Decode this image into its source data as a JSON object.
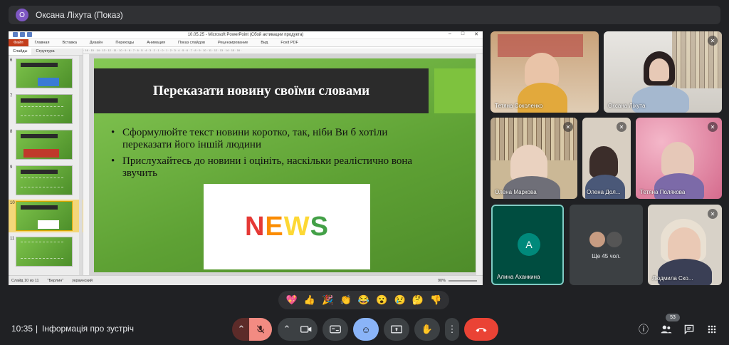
{
  "presenter": {
    "initial": "O",
    "name": "Оксана Ліхута (Показ)"
  },
  "ppt": {
    "window_title": "10.05.25 - Microsoft PowerPoint (Сбой активации продукта)",
    "ribbon_tabs": [
      "Файл",
      "Главная",
      "Вставка",
      "Дизайн",
      "Переходы",
      "Анимация",
      "Показ слайдов",
      "Рецензирование",
      "Вид",
      "Foxit PDF"
    ],
    "panel_tabs": [
      "Слайды",
      "Структура"
    ],
    "thumbnails": [
      {
        "num": "6",
        "title": "Практичне завдання"
      },
      {
        "num": "7",
        "title": "Що нового?"
      },
      {
        "num": "8",
        "title": "Обговорення новин"
      },
      {
        "num": "9",
        "title": "Вправа"
      },
      {
        "num": "10",
        "title": "Переказати новину своїми словами",
        "selected": true
      },
      {
        "num": "11",
        "title": ""
      }
    ],
    "slide": {
      "title": "Переказати новину своїми словами",
      "bullets": [
        "Сформулюйте текст новини коротко, так, ніби Ви б хотіли переказати його іншій людини",
        "Прислухайтесь до новини і оцініть, наскільки реалістично вона звучить"
      ],
      "image_letters": [
        "N",
        "E",
        "W",
        "S"
      ]
    },
    "status": {
      "slide": "Слайд 10 из 11",
      "theme": "\"Берлин\"",
      "lang": "украинский",
      "zoom": "90%"
    }
  },
  "participants": [
    {
      "name": "Тетяна Соколенко",
      "muted": false
    },
    {
      "name": "Оксана Ліхута",
      "muted": true
    },
    {
      "name": "Олена Маркова",
      "muted": true
    },
    {
      "name": "Олена Дол...",
      "muted": true
    },
    {
      "name": "Тетяна Полякова",
      "muted": true
    },
    {
      "name": "Алина Аханкина",
      "initial": "A",
      "muted": false
    },
    {
      "name": "Ще 45 чол.",
      "muted": false
    },
    {
      "name": "Людмила Ско...",
      "muted": true
    }
  ],
  "reactions": [
    "💖",
    "👍",
    "🎉",
    "👏",
    "😂",
    "😮",
    "😢",
    "🤔",
    "👎"
  ],
  "bottom": {
    "time": "10:35",
    "separator": "|",
    "info": "Інформація про зустріч",
    "people_count": "53"
  },
  "colors": {
    "accent_blue": "#8ab4f8",
    "hang_red": "#ea4335",
    "mic_off": "#f28b82",
    "slide_green": "#5ea134"
  }
}
